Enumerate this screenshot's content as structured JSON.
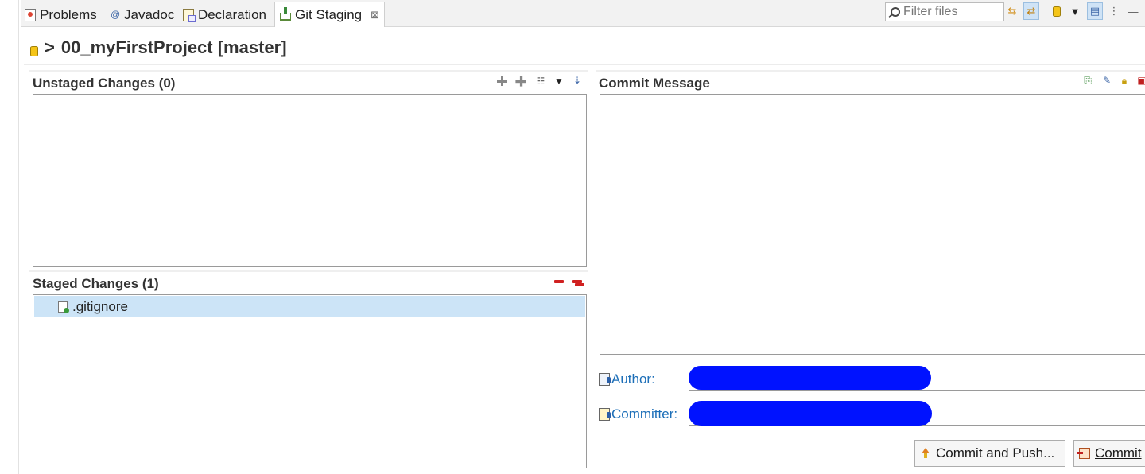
{
  "tabs": [
    {
      "label": "Problems",
      "icon": "problems-icon"
    },
    {
      "label": "Javadoc",
      "icon": "javadoc-icon"
    },
    {
      "label": "Declaration",
      "icon": "declaration-icon"
    },
    {
      "label": "Git Staging",
      "icon": "git-staging-icon",
      "active": true,
      "close": "⊠"
    }
  ],
  "toolbar": {
    "filter_placeholder": "Filter files",
    "icons": [
      "refresh-icon",
      "link-with-selection-icon",
      "repository-icon",
      "dropdown-icon",
      "layout-icon",
      "view-menu-icon",
      "minimize-icon"
    ]
  },
  "repo": {
    "prefix": ">",
    "title": "00_myFirstProject [master]"
  },
  "unstaged": {
    "title": "Unstaged Changes (0)",
    "items": []
  },
  "staged": {
    "title": "Staged Changes (1)",
    "items": [
      ".gitignore"
    ]
  },
  "commit": {
    "title": "Commit Message",
    "message": "",
    "author_label": "Author:",
    "committer_label": "Committer:",
    "commit_and_push_label": "Commit and Push...",
    "commit_label": "Commit"
  },
  "colors": {
    "selection": "#cce4f7",
    "link_blue": "#1d6fb8",
    "redaction": "#0012ff"
  }
}
